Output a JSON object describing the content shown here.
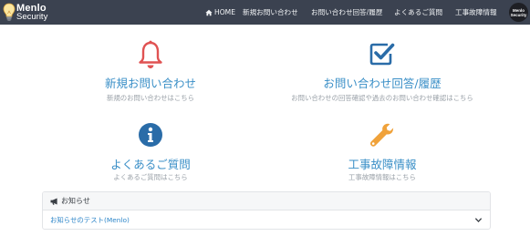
{
  "header": {
    "logo": {
      "line1": "Menlo",
      "line2": "Security"
    },
    "nav": [
      {
        "label": "HOME",
        "icon": "home-icon"
      },
      {
        "label": "新規お問い合わせ"
      },
      {
        "label": "お問い合わせ回答/履歴"
      },
      {
        "label": "よくあるご質問"
      },
      {
        "label": "工事故障情報"
      }
    ],
    "avatar": {
      "line1": "Menlo",
      "line2": "Security"
    }
  },
  "tiles": [
    {
      "title": "新規お問い合わせ",
      "subtitle": "新規のお問い合わせはこちら",
      "icon": "bell-icon",
      "icon_color": "#e05252"
    },
    {
      "title": "お問い合わせ回答/履歴",
      "subtitle": "お問い合わせの回答確認や過去のお問い合わせ確認はこちら",
      "icon": "checkbox-icon",
      "icon_color": "#2a6ca8"
    },
    {
      "title": "よくあるご質問",
      "subtitle": "よくあるご質問はこちら",
      "icon": "info-icon",
      "icon_color": "#2a6ca8"
    },
    {
      "title": "工事故障情報",
      "subtitle": "工事故障情報はこちら",
      "icon": "wrench-icon",
      "icon_color": "#f0a23a"
    }
  ],
  "notice": {
    "heading": "お知らせ",
    "items": [
      {
        "label": "お知らせのテスト(Menlo)"
      }
    ]
  },
  "colors": {
    "header_bg": "#3b4250",
    "link": "#3a8fc7",
    "bell": "#e05252",
    "check": "#2a6ca8",
    "info": "#2a6ca8",
    "wrench": "#f0a23a"
  }
}
